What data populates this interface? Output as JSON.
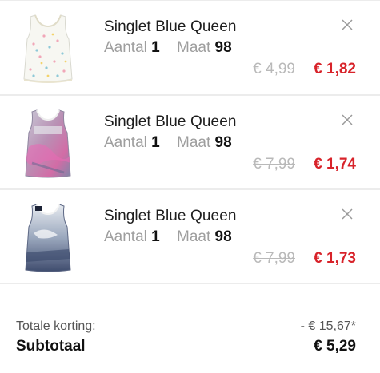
{
  "cart": {
    "items": [
      {
        "name": "Singlet Blue Queen",
        "qty_label": "Aantal",
        "qty": "1",
        "size_label": "Maat",
        "size": "98",
        "old_price": "€ 4,99",
        "new_price": "€ 1,82",
        "image_icon": "white-polka-dot-singlet"
      },
      {
        "name": "Singlet Blue Queen",
        "qty_label": "Aantal",
        "qty": "1",
        "size_label": "Maat",
        "size": "98",
        "old_price": "€ 7,99",
        "new_price": "€ 1,74",
        "image_icon": "pink-print-singlet"
      },
      {
        "name": "Singlet Blue Queen",
        "qty_label": "Aantal",
        "qty": "1",
        "size_label": "Maat",
        "size": "98",
        "old_price": "€ 7,99",
        "new_price": "€ 1,73",
        "image_icon": "blue-print-singlet"
      }
    ]
  },
  "summary": {
    "discount_label": "Totale korting:",
    "discount_value": "- € 15,67*",
    "subtotal_label": "Subtotaal",
    "subtotal_value": "€ 5,29"
  },
  "colors": {
    "sale_price": "#d8232a",
    "old_price": "#b9b9b9",
    "muted_text": "#9e9e9e"
  }
}
